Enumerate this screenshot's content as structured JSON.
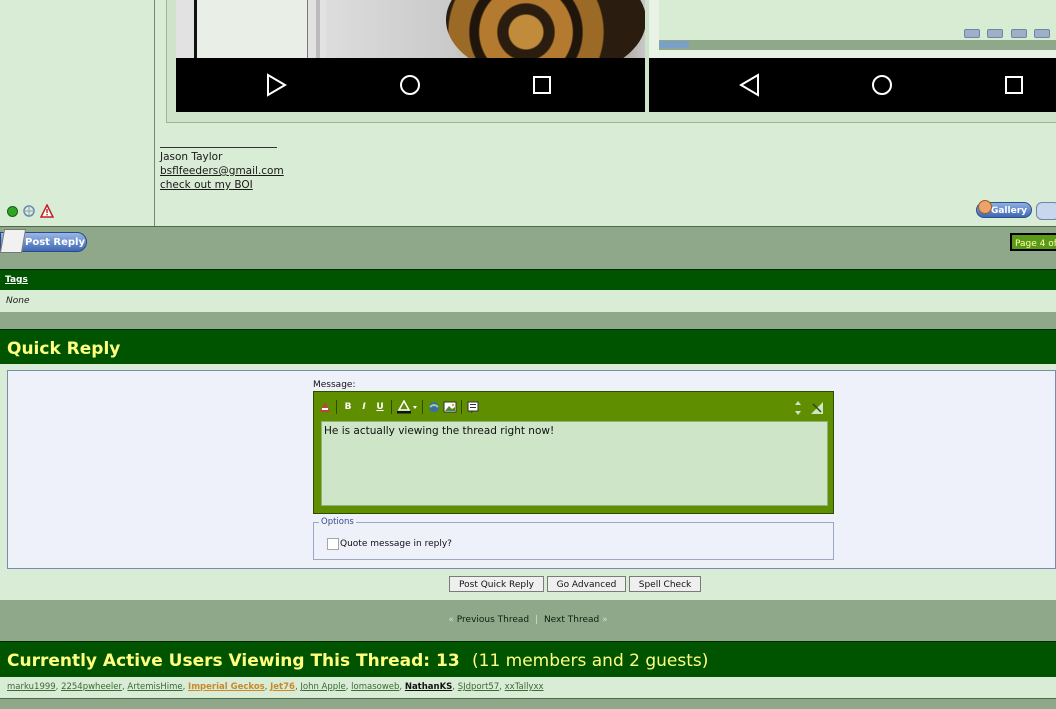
{
  "post": {
    "signature": {
      "name": "Jason Taylor",
      "email": "bsflfeeders@gmail.com",
      "link": "check out my BOI"
    },
    "gallery_label": "Gallery"
  },
  "post_reply_label": "Post Reply",
  "page_label": "Page 4 of",
  "tags": {
    "title": "Tags",
    "value": "None"
  },
  "quick_reply": {
    "title": "Quick Reply",
    "message_label": "Message:",
    "message_text": "He is actually viewing the thread right now!",
    "options_legend": "Options",
    "quote_label": "Quote message in reply?",
    "buttons": {
      "post_quick_reply": "Post Quick Reply",
      "go_advanced": "Go Advanced",
      "spell_check": "Spell Check"
    }
  },
  "thread_nav": {
    "previous": "Previous Thread",
    "next": "Next Thread"
  },
  "active_users": {
    "title": "Currently Active Users Viewing This Thread: 13",
    "summary": "(11 members and 2 guests)",
    "users": [
      "marku1999",
      "2254pwheeler",
      "ArtemisHime",
      "Imperial Geckos",
      "Jet76",
      "John Apple",
      "lomasoweb",
      "NathanKS",
      "SJdport57",
      "xxTallyxx"
    ]
  },
  "colors": {
    "header_green": "#005400",
    "header_text": "#ffff80",
    "panel_bg": "#d9ecd5",
    "strip_bg": "#8fa88a",
    "editor_green": "#5f8e00"
  }
}
